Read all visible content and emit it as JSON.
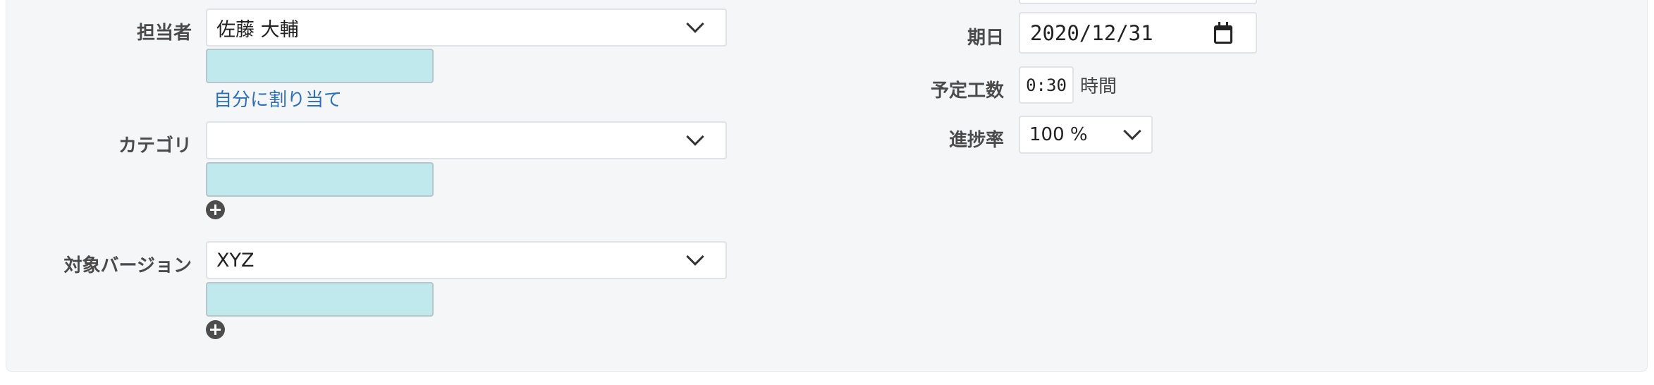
{
  "assignee": {
    "label": "担当者",
    "value": "佐藤 大輔",
    "assign_to_me": "自分に割り当て"
  },
  "category": {
    "label": "カテゴリ",
    "value": ""
  },
  "target_version": {
    "label": "対象バージョン",
    "value": "XYZ"
  },
  "due_date": {
    "label": "期日",
    "value": "2020/12/31"
  },
  "estimated_time": {
    "label": "予定工数",
    "value": "0:30",
    "unit": "時間"
  },
  "progress": {
    "label": "進捗率",
    "value": "100 %"
  },
  "icons": {
    "dropdown": "chevron-down-icon",
    "add": "plus-circle-icon",
    "calendar": "calendar-icon"
  },
  "colors": {
    "panel_background": "#f5f6f8",
    "highlight_box": "#bfe9ec",
    "link": "#2d6fb8"
  }
}
